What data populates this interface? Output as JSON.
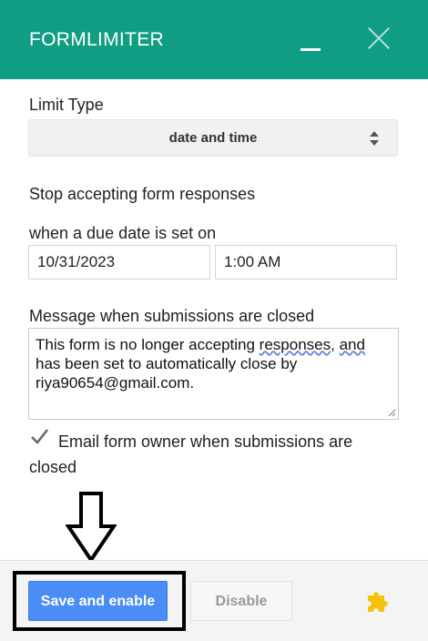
{
  "header": {
    "title": "FORMLIMITER",
    "minimize_icon": "minimize-icon",
    "close_icon": "close-icon",
    "color": "#0f9d84"
  },
  "limit_type": {
    "label": "Limit Type",
    "selected": "date and time"
  },
  "stop_section": {
    "heading": "Stop accepting form responses",
    "due_label": "when a due date is set on",
    "date_value": "10/31/2023",
    "time_value": "1:00 AM"
  },
  "message": {
    "label": "Message when submissions are closed",
    "text_part1": "This form is no longer accepting ",
    "text_underlined1": "responses,",
    "text_space": " ",
    "text_underlined2": "and",
    "text_part2": " has been set to automatically close by riya90654@gmail.com."
  },
  "email_owner": {
    "checked": true,
    "label": "Email form owner when submissions are closed"
  },
  "footer": {
    "save_label": "Save and enable",
    "disable_label": "Disable",
    "addon_icon": "puzzle-icon",
    "primary_color": "#4a8df6"
  },
  "annotation": {
    "arrow_icon": "down-arrow-icon"
  }
}
